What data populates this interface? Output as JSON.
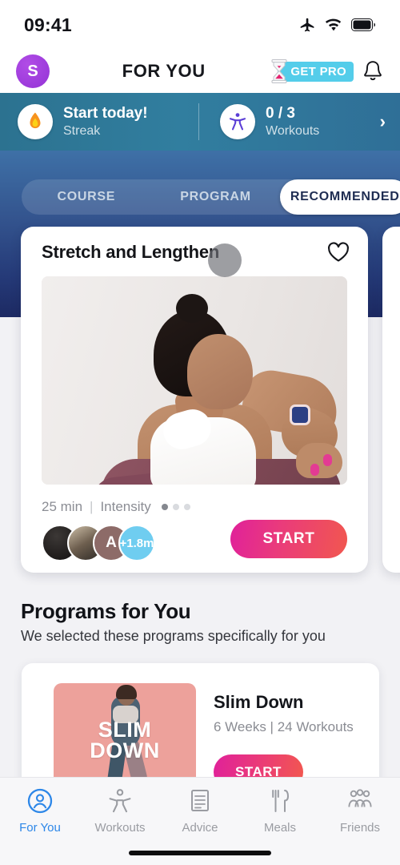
{
  "status_bar": {
    "time": "09:41",
    "icons": [
      "airplane-mode-icon",
      "wifi-icon",
      "battery-icon"
    ]
  },
  "header": {
    "avatar_initial": "S",
    "title": "FOR YOU",
    "get_pro_label": "GET PRO",
    "get_pro_color": "#54cdea",
    "hourglass_icon": "hourglass-icon",
    "bell_icon": "bell-icon"
  },
  "stats_bar": {
    "background_color": "#317e9f",
    "streak": {
      "icon": "flame-icon",
      "title": "Start today!",
      "subtitle": "Streak"
    },
    "workouts": {
      "icon": "person-stretch-icon",
      "title": "0 / 3",
      "subtitle": "Workouts"
    },
    "chevron": "›"
  },
  "tabs": {
    "items": [
      {
        "label": "COURSE",
        "active": false
      },
      {
        "label": "PROGRAM",
        "active": false
      },
      {
        "label": "RECOMMENDED",
        "active": true
      }
    ]
  },
  "workout_card": {
    "title": "Stretch and Lengthen",
    "favorite_icon": "heart-outline-icon",
    "duration": "25 min",
    "separator": "|",
    "intensity_label": "Intensity",
    "intensity_level": 1,
    "intensity_max": 3,
    "participants_badge": "+1.8m",
    "avatar_initial": "A",
    "start_label": "START",
    "start_gradient_from": "#e0219a",
    "start_gradient_to": "#f1574f"
  },
  "programs_section": {
    "title": "Programs for You",
    "subtitle": "We selected these programs specifically for you",
    "cards": [
      {
        "thumb_line1": "SLIM",
        "thumb_line2": "DOWN",
        "thumb_color": "#eda19b",
        "title": "Slim Down",
        "meta": "6 Weeks | 24 Workouts",
        "start_label": "START"
      }
    ]
  },
  "bottom_nav": {
    "active_color": "#2d87e8",
    "items": [
      {
        "label": "For You",
        "icon": "person-circle-icon",
        "active": true
      },
      {
        "label": "Workouts",
        "icon": "person-stretch-icon",
        "active": false
      },
      {
        "label": "Advice",
        "icon": "document-lines-icon",
        "active": false
      },
      {
        "label": "Meals",
        "icon": "fork-knife-icon",
        "active": false
      },
      {
        "label": "Friends",
        "icon": "people-group-icon",
        "active": false
      }
    ]
  }
}
